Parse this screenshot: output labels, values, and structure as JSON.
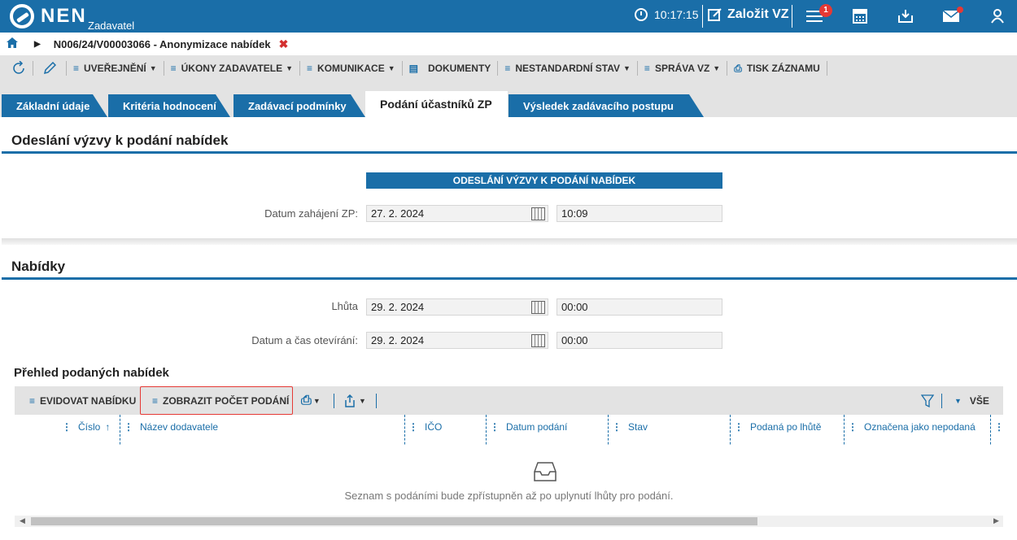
{
  "app": {
    "logo": "NEN",
    "subtitle": "Zadavatel"
  },
  "topbar": {
    "time": "10:17:15",
    "create_label": "Založit VZ",
    "notification_count": "1"
  },
  "breadcrumb": {
    "title": "N006/24/V00003066 - Anonymizace nabídek"
  },
  "actions": [
    {
      "label": "UVEŘEJNĚNÍ"
    },
    {
      "label": "ÚKONY ZADAVATELE"
    },
    {
      "label": "KOMUNIKACE"
    },
    {
      "label": "DOKUMENTY"
    },
    {
      "label": "NESTANDARDNÍ STAV"
    },
    {
      "label": "SPRÁVA VZ"
    },
    {
      "label": "TISK ZÁZNAMU"
    }
  ],
  "tabs": [
    {
      "label": "Základní údaje"
    },
    {
      "label": "Kritéria hodnocení"
    },
    {
      "label": "Zadávací podmínky"
    },
    {
      "label": "Podání účastníků ZP"
    },
    {
      "label": "Výsledek zadávacího postupu"
    }
  ],
  "section1": {
    "title": "Odeslání výzvy k podání nabídek",
    "banner": "ODESLÁNÍ VÝZVY K PODÁNÍ NABÍDEK",
    "start_label": "Datum zahájení ZP:",
    "start_date": "27. 2. 2024",
    "start_time": "10:09"
  },
  "section2": {
    "title": "Nabídky",
    "deadline_label": "Lhůta",
    "deadline_date": "29. 2. 2024",
    "deadline_time": "00:00",
    "open_label": "Datum a čas otevírání:",
    "open_date": "29. 2. 2024",
    "open_time": "00:00"
  },
  "grid": {
    "title": "Přehled podaných nabídek",
    "btn_register": "EVIDOVAT NABÍDKU",
    "btn_count": "ZOBRAZIT POČET PODÁNÍ",
    "filter_all": "VŠE",
    "columns": [
      {
        "label": "Číslo"
      },
      {
        "label": "Název dodavatele"
      },
      {
        "label": "IČO"
      },
      {
        "label": "Datum podání"
      },
      {
        "label": "Stav"
      },
      {
        "label": "Podaná po lhůtě"
      },
      {
        "label": "Označena jako nepodaná"
      }
    ],
    "empty_text": "Seznam s podáními bude zpřístupněn až po uplynutí lhůty pro podání."
  },
  "colors": {
    "primary": "#1a6ea8",
    "highlight": "#e53935",
    "toolbar_bg": "#e3e3e3"
  }
}
